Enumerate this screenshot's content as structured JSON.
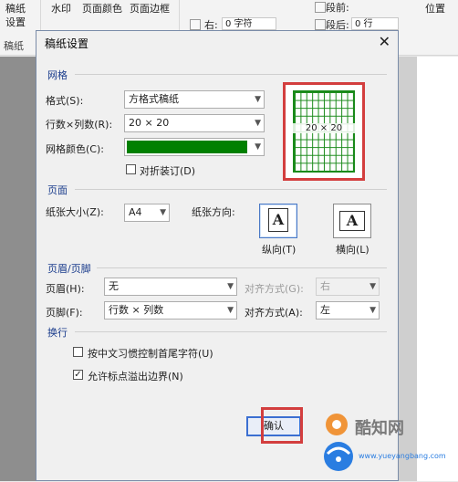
{
  "ribbon": {
    "gaozhi_top": "稿纸",
    "gaozhi_bottom": "设置",
    "watermark": "水印",
    "page_color": "页面颜色",
    "page_border": "页面边框",
    "indent_right_label": "右:",
    "indent_right_value": "0 字符",
    "spacing_before_label": "段前:",
    "spacing_after_label": "段后:",
    "spacing_after_value": "0 行",
    "position_label": "位置",
    "group_label": "稿纸"
  },
  "dialog": {
    "title": "稿纸设置",
    "grid_section": "网格",
    "format_label": "格式(S):",
    "format_value": "方格式稿纸",
    "rowscols_label": "行数×列数(R):",
    "rowscols_value": "20 × 20",
    "grid_color_label": "网格颜色(C):",
    "grid_color_hex": "#008000",
    "fold_label": "对折装订(D)",
    "preview_text": "20 × 20",
    "page_section": "页面",
    "paper_size_label": "纸张大小(Z):",
    "paper_size_value": "A4",
    "orientation_label": "纸张方向:",
    "portrait_label": "纵向(T)",
    "landscape_label": "横向(L)",
    "hf_section": "页眉/页脚",
    "header_label": "页眉(H):",
    "header_value": "无",
    "header_align_label": "对齐方式(G):",
    "header_align_value": "右",
    "footer_label": "页脚(F):",
    "footer_value": "行数 × 列数",
    "footer_align_label": "对齐方式(A):",
    "footer_align_value": "左",
    "wrap_section": "换行",
    "wrap_opt1": "按中文习惯控制首尾字符(U)",
    "wrap_opt2": "允许标点溢出边界(N)",
    "ok_label": "确认"
  },
  "watermark": {
    "brand": "酷知网",
    "site": "www.yueyangbang.com"
  },
  "colors": {
    "accent_red": "#d33e3e",
    "grid_green": "#1a8a1a",
    "section_blue": "#1a3c8c"
  }
}
